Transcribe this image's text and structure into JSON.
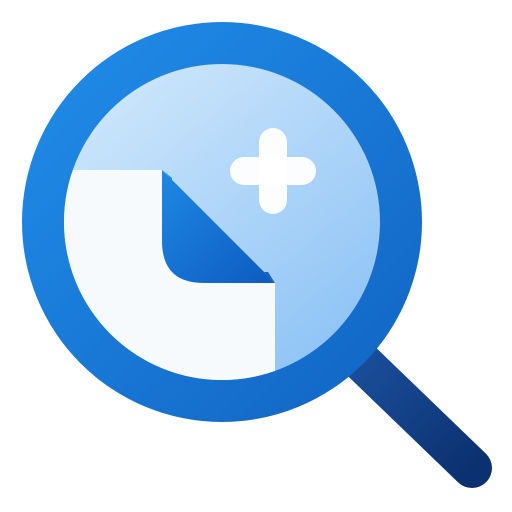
{
  "icon": {
    "semantic_name": "magnifier-new-document-icon",
    "parts": [
      "magnifier-icon",
      "document-icon",
      "plus-icon"
    ]
  },
  "colors": {
    "ring_outer": "#1e88e5",
    "ring_inner_shadow": "#1565c0",
    "lens_light": "#bbdefb",
    "lens_mid": "#90caf9",
    "handle_dark": "#0d3b7a",
    "handle_light": "#1a4e9a",
    "document_face": "#ffffff",
    "document_fold_top": "#1e88e5",
    "document_fold_bottom": "#0d47a1",
    "plus": "#ffffff"
  }
}
